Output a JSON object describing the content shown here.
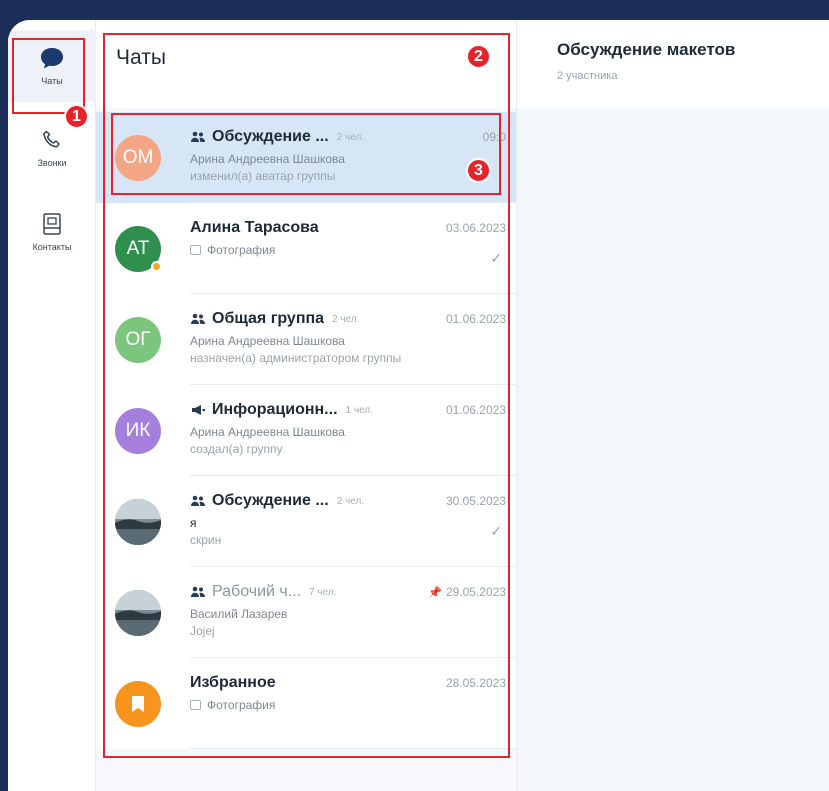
{
  "nav": {
    "items": [
      {
        "label": "Чаты",
        "icon": "chat-bubble-icon"
      },
      {
        "label": "Звонки",
        "icon": "phone-icon"
      },
      {
        "label": "Контакты",
        "icon": "contacts-book-icon"
      }
    ]
  },
  "chat_list": {
    "title": "Чаты",
    "chats": [
      {
        "initials": "ОМ",
        "avatar_color": "#f4a585",
        "type": "group",
        "name": "Обсуждение ...",
        "members": "2 чел.",
        "date": "09:0",
        "line1": "Арина Андреевна Шашкова",
        "line2": "изменил(а) аватар группы",
        "selected": true
      },
      {
        "initials": "АТ",
        "avatar_color": "#2f8f4e",
        "type": "person",
        "name": "Алина Тарасова",
        "members": "",
        "date": "03.06.2023",
        "line1": "Фотография",
        "line2": "",
        "read": "✓",
        "online": true
      },
      {
        "initials": "ОГ",
        "avatar_color": "#7cc57d",
        "type": "group",
        "name": "Общая группа",
        "members": "2 чел.",
        "date": "01.06.2023",
        "line1": "Арина Андреевна Шашкова",
        "line2": "назначен(а) администратором группы"
      },
      {
        "initials": "ИК",
        "avatar_color": "#a47fdc",
        "type": "channel",
        "name": "Инфорационн...",
        "members": "1 чел.",
        "date": "01.06.2023",
        "line1": "Арина Андреевна Шашкова",
        "line2": "создал(а) группу"
      },
      {
        "initials": "",
        "avatar_color": "#6b7f8e",
        "type": "group",
        "name": "Обсуждение ...",
        "members": "2 чел.",
        "date": "30.05.2023",
        "line1": "я",
        "line2": "скрин",
        "read": "✓"
      },
      {
        "initials": "",
        "avatar_color": "#7a8a8f",
        "type": "group",
        "name": "Рабочий ч...",
        "members": "7 чел.",
        "date": "29.05.2023",
        "line1": "Василий Лазарев",
        "line2": "Jojej",
        "muted": true,
        "pinned": true
      },
      {
        "initials": "",
        "avatar_color": "#f7941d",
        "type": "favorites",
        "name": "Избранное",
        "members": "",
        "date": "28.05.2023",
        "line1": "Фотография",
        "line2": ""
      }
    ]
  },
  "conversation": {
    "title": "Обсуждение макетов",
    "subtitle": "2 участника"
  },
  "annotations": [
    "1",
    "2",
    "3"
  ],
  "colors": {
    "accent_red": "#e3242b",
    "top_bar": "#1b2e57",
    "selected_row": "#d6e6f7"
  }
}
